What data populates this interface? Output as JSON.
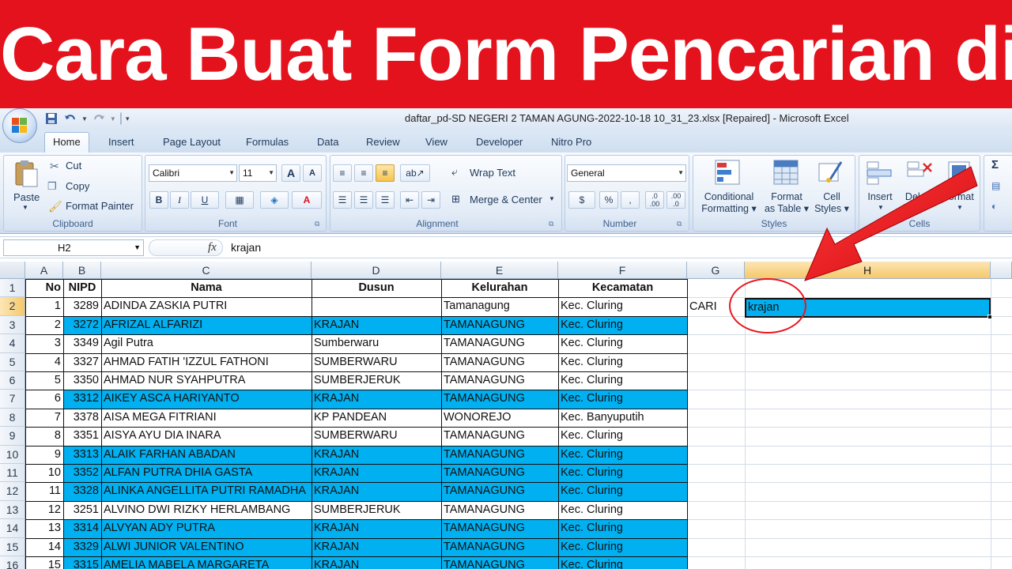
{
  "banner": {
    "text": "Cara Buat Form Pencarian di Excel"
  },
  "window": {
    "title": "daftar_pd-SD NEGERI 2 TAMAN AGUNG-2022-10-18 10_31_23.xlsx [Repaired] - Microsoft Excel"
  },
  "qat": {
    "save_icon": "save-icon",
    "undo_icon": "undo-icon",
    "redo_icon": "redo-icon",
    "customize_icon": "dropdown-icon"
  },
  "tabs": [
    {
      "label": "Home",
      "active": true
    },
    {
      "label": "Insert"
    },
    {
      "label": "Page Layout"
    },
    {
      "label": "Formulas"
    },
    {
      "label": "Data"
    },
    {
      "label": "Review"
    },
    {
      "label": "View"
    },
    {
      "label": "Developer"
    },
    {
      "label": "Nitro Pro"
    }
  ],
  "ribbon": {
    "clipboard": {
      "label": "Clipboard",
      "paste": "Paste",
      "cut": "Cut",
      "copy": "Copy",
      "format_painter": "Format Painter"
    },
    "font": {
      "label": "Font",
      "family": "Calibri",
      "size": "11",
      "bold": "B",
      "italic": "I",
      "underline": "U",
      "grow": "A",
      "shrink": "A",
      "font_color": "A"
    },
    "alignment": {
      "label": "Alignment",
      "wrap_text": "Wrap Text",
      "merge_center": "Merge & Center"
    },
    "number": {
      "label": "Number",
      "format": "General",
      "currency": "$",
      "percent": "%",
      "comma": ",",
      "inc_dec": ".0 .00",
      "dec_dec": ".00 .0"
    },
    "styles": {
      "label": "Styles",
      "conditional": [
        "Conditional",
        "Formatting"
      ],
      "format_table": [
        "Format",
        "as Table"
      ],
      "cell_styles": [
        "Cell",
        "Styles"
      ]
    },
    "cells": {
      "label": "Cells",
      "insert": "Insert",
      "delete": "Delete",
      "format": "Format"
    }
  },
  "formula_bar": {
    "name_box": "H2",
    "fx": "fx",
    "value": "krajan"
  },
  "columns": [
    {
      "label": "A",
      "selected": false
    },
    {
      "label": "B",
      "selected": false
    },
    {
      "label": "C",
      "selected": false
    },
    {
      "label": "D",
      "selected": false
    },
    {
      "label": "E",
      "selected": false
    },
    {
      "label": "F",
      "selected": false
    },
    {
      "label": "G",
      "selected": false
    },
    {
      "label": "H",
      "selected": true
    }
  ],
  "table": {
    "headers": [
      "No",
      "NIPD",
      "Nama",
      "Dusun",
      "Kelurahan",
      "Kecamatan"
    ],
    "rows": [
      {
        "no": "1",
        "nipd": "3289",
        "nama": "ADINDA ZASKIA PUTRI",
        "dusun": "",
        "kelurahan": "Tamanagung",
        "kecamatan": "Kec. Cluring",
        "hl": false
      },
      {
        "no": "2",
        "nipd": "3272",
        "nama": "AFRIZAL ALFARIZI",
        "dusun": "KRAJAN",
        "kelurahan": "TAMANAGUNG",
        "kecamatan": "Kec. Cluring",
        "hl": true
      },
      {
        "no": "3",
        "nipd": "3349",
        "nama": "Agil Putra",
        "dusun": "Sumberwaru",
        "kelurahan": "TAMANAGUNG",
        "kecamatan": "Kec. Cluring",
        "hl": false
      },
      {
        "no": "4",
        "nipd": "3327",
        "nama": "AHMAD FATIH 'IZZUL FATHONI",
        "dusun": "SUMBERWARU",
        "kelurahan": "TAMANAGUNG",
        "kecamatan": "Kec. Cluring",
        "hl": false
      },
      {
        "no": "5",
        "nipd": "3350",
        "nama": "AHMAD NUR SYAHPUTRA",
        "dusun": "SUMBERJERUK",
        "kelurahan": "TAMANAGUNG",
        "kecamatan": "Kec. Cluring",
        "hl": false
      },
      {
        "no": "6",
        "nipd": "3312",
        "nama": "AIKEY ASCA HARIYANTO",
        "dusun": "KRAJAN",
        "kelurahan": "TAMANAGUNG",
        "kecamatan": "Kec. Cluring",
        "hl": true
      },
      {
        "no": "7",
        "nipd": "3378",
        "nama": "AISA MEGA FITRIANI",
        "dusun": "KP PANDEAN",
        "kelurahan": "WONOREJO",
        "kecamatan": "Kec. Banyuputih",
        "hl": false
      },
      {
        "no": "8",
        "nipd": "3351",
        "nama": "AISYA AYU DIA INARA",
        "dusun": "SUMBERWARU",
        "kelurahan": "TAMANAGUNG",
        "kecamatan": "Kec. Cluring",
        "hl": false
      },
      {
        "no": "9",
        "nipd": "3313",
        "nama": "ALAIK FARHAN ABADAN",
        "dusun": "KRAJAN",
        "kelurahan": "TAMANAGUNG",
        "kecamatan": "Kec. Cluring",
        "hl": true
      },
      {
        "no": "10",
        "nipd": "3352",
        "nama": "ALFAN PUTRA DHIA GASTA",
        "dusun": "KRAJAN",
        "kelurahan": "TAMANAGUNG",
        "kecamatan": "Kec. Cluring",
        "hl": true
      },
      {
        "no": "11",
        "nipd": "3328",
        "nama": "ALINKA ANGELLITA PUTRI RAMADHA",
        "dusun": "KRAJAN",
        "kelurahan": "TAMANAGUNG",
        "kecamatan": "Kec. Cluring",
        "hl": true
      },
      {
        "no": "12",
        "nipd": "3251",
        "nama": "ALVINO DWI RIZKY HERLAMBANG",
        "dusun": "SUMBERJERUK",
        "kelurahan": "TAMANAGUNG",
        "kecamatan": "Kec. Cluring",
        "hl": false
      },
      {
        "no": "13",
        "nipd": "3314",
        "nama": "ALVYAN ADY PUTRA",
        "dusun": "KRAJAN",
        "kelurahan": "TAMANAGUNG",
        "kecamatan": "Kec. Cluring",
        "hl": true
      },
      {
        "no": "14",
        "nipd": "3329",
        "nama": "ALWI JUNIOR VALENTINO",
        "dusun": "KRAJAN",
        "kelurahan": "TAMANAGUNG",
        "kecamatan": "Kec. Cluring",
        "hl": true
      },
      {
        "no": "15",
        "nipd": "3315",
        "nama": "AMELIA MABELA MARGARETA",
        "dusun": "KRAJAN",
        "kelurahan": "TAMANAGUNG",
        "kecamatan": "Kec. Cluring",
        "hl": true
      }
    ]
  },
  "search": {
    "label": "CARI",
    "value": "krajan"
  },
  "row_numbers": [
    "1",
    "2",
    "3",
    "4",
    "5",
    "6",
    "7",
    "8",
    "9",
    "10",
    "11",
    "12",
    "13",
    "14",
    "15",
    "16"
  ],
  "colors": {
    "banner": "#e4121c",
    "highlight": "#00b0f0",
    "annotation": "#e8171d"
  },
  "annotations": {
    "arrow_icon": "red-arrow-icon",
    "circle_icon": "red-circle-icon"
  }
}
